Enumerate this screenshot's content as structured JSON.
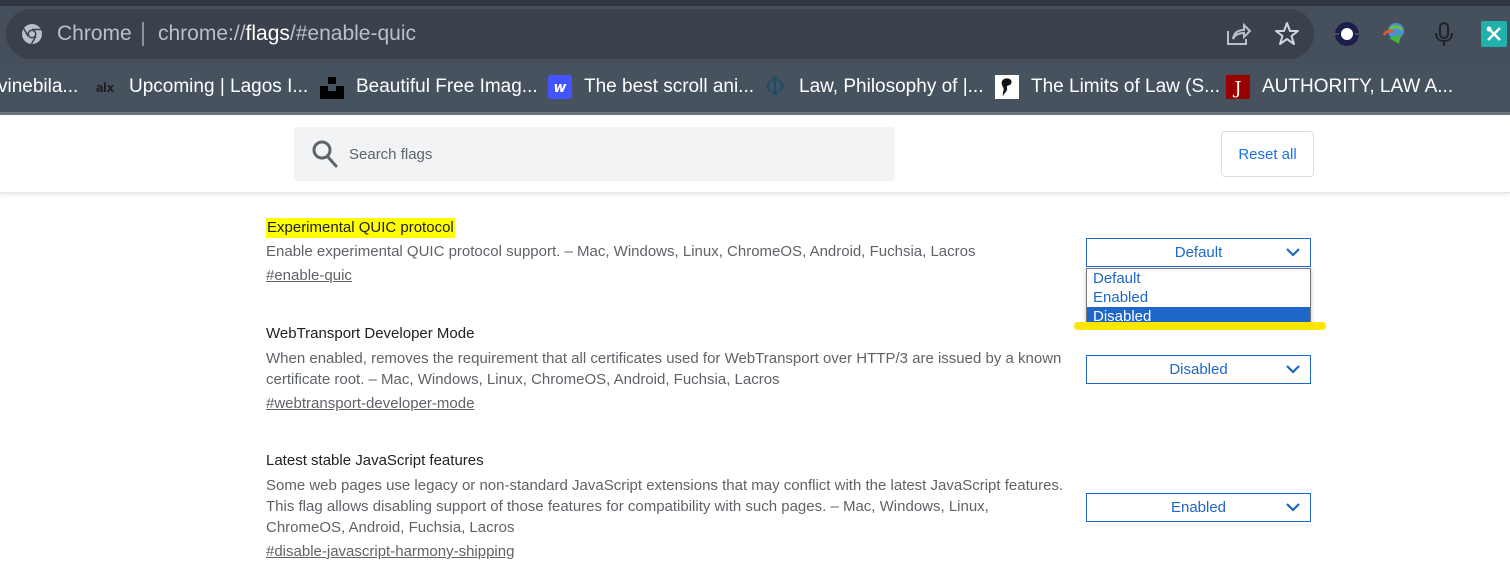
{
  "browser": {
    "omnibox": {
      "chip": "Chrome",
      "url_scheme": "chrome://",
      "url_host": "flags",
      "url_rest": "/#enable-quic"
    },
    "toolbar_icons": [
      "share-icon",
      "bookmark-star-icon",
      "extension-circle-icon",
      "download-manager-icon",
      "microphone-icon",
      "tools-extension-icon"
    ],
    "bookmarks": [
      {
        "label": "vinebila...",
        "icon": "none"
      },
      {
        "label": "Upcoming | Lagos I...",
        "icon": "alx-icon"
      },
      {
        "label": "Beautiful Free Imag...",
        "icon": "unsplash-icon"
      },
      {
        "label": "The best scroll ani...",
        "icon": "webflow-icon"
      },
      {
        "label": "Law, Philosophy of |...",
        "icon": "phi-icon"
      },
      {
        "label": "The Limits of Law (S...",
        "icon": "thinker-icon"
      },
      {
        "label": "AUTHORITY, LAW A...",
        "icon": "jstor-icon"
      }
    ]
  },
  "flags_page": {
    "search": {
      "placeholder": "Search flags",
      "value": ""
    },
    "reset_all_label": "Reset all",
    "experiments": [
      {
        "title": "Experimental QUIC protocol",
        "highlighted": true,
        "description": "Enable experimental QUIC protocol support. – Mac, Windows, Linux, ChromeOS, Android, Fuchsia, Lacros",
        "link": "#enable-quic",
        "selected": "Default",
        "dropdown_open": true,
        "options": [
          "Default",
          "Enabled",
          "Disabled"
        ],
        "highlighted_option": "Disabled"
      },
      {
        "title": "WebTransport Developer Mode",
        "highlighted": false,
        "description": "When enabled, removes the requirement that all certificates used for WebTransport over HTTP/3 are issued by a known certificate root. – Mac, Windows, Linux, ChromeOS, Android, Fuchsia, Lacros",
        "link": "#webtransport-developer-mode",
        "selected": "Disabled"
      },
      {
        "title": "Latest stable JavaScript features",
        "highlighted": false,
        "description": "Some web pages use legacy or non-standard JavaScript extensions that may conflict with the latest JavaScript features. This flag allows disabling support of those features for compatibility with such pages. – Mac, Windows, Linux, ChromeOS, Android, Fuchsia, Lacros",
        "link": "#disable-javascript-harmony-shipping",
        "selected": "Enabled"
      }
    ]
  },
  "colors": {
    "accent": "#1f66c9",
    "highlight": "#ffff00",
    "annotation_underline": "#ffe600",
    "toolbar": "#464f5c"
  }
}
